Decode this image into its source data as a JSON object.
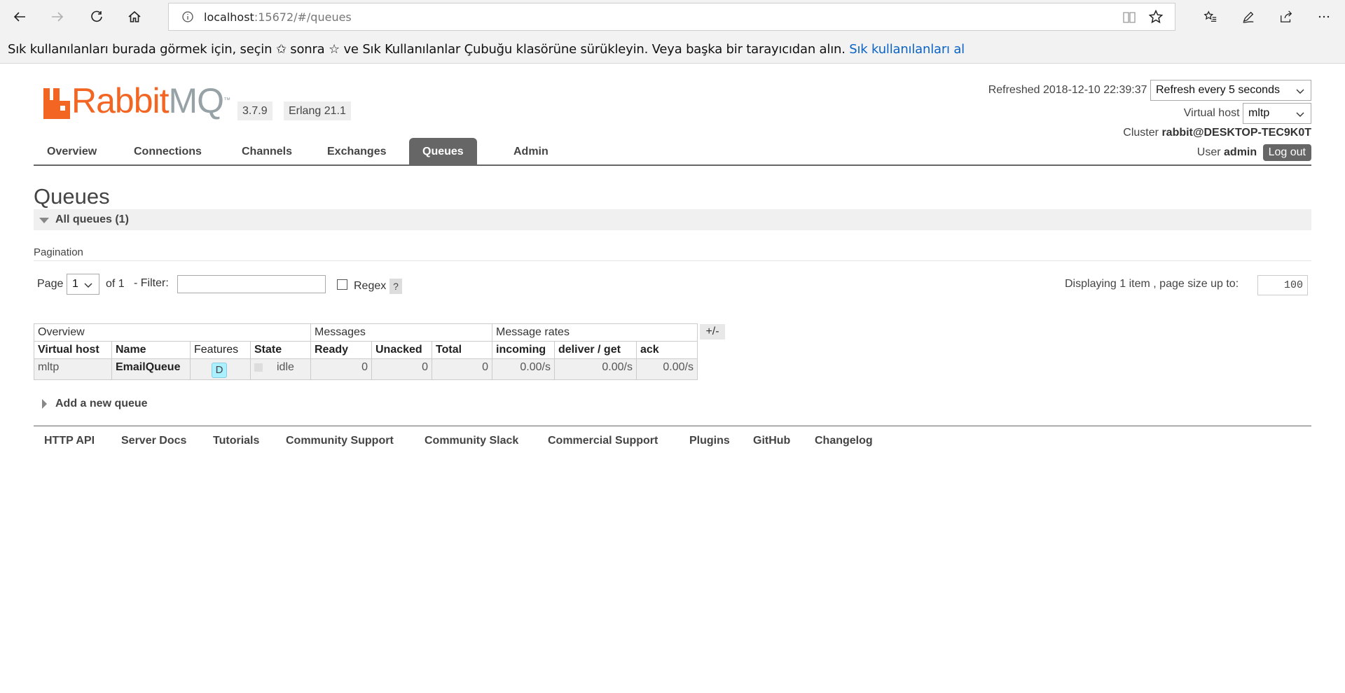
{
  "browser": {
    "url_host": "localhost",
    "url_path": ":15672/#/queues",
    "favorites_bar": {
      "text_before_icon": "Sık kullanılanları burada görmek için, seçin",
      "text_icon": "✩",
      "text_after_icon": "sonra ☆ ve Sık Kullanılanlar Çubuğu klasörüne sürükleyin. Veya başka bir tarayıcıdan alın.",
      "link": "Sık kullanılanları al"
    },
    "icons": [
      "back-icon",
      "forward-icon",
      "refresh-icon",
      "home-icon",
      "info-icon",
      "reading-view-icon",
      "favorite-star-icon",
      "favorites-list-icon",
      "pen-icon",
      "share-icon",
      "more-icon"
    ]
  },
  "header": {
    "logo_rabbit": "Rabbit",
    "logo_mq": "MQ",
    "logo_tm": "™",
    "version": "3.7.9",
    "erlang": "Erlang 21.1",
    "refreshed_label": "Refreshed",
    "refreshed_time": "2018-12-10 22:39:37",
    "refresh_select": "Refresh every 5 seconds",
    "vhost_label": "Virtual host",
    "vhost_select": "mltp",
    "cluster_label": "Cluster",
    "cluster_name": "rabbit@DESKTOP-TEC9K0T",
    "user_label": "User",
    "user_name": "admin",
    "logout": "Log out",
    "brand_color": "#f26522"
  },
  "tabs": [
    {
      "label": "Overview"
    },
    {
      "label": "Connections"
    },
    {
      "label": "Channels"
    },
    {
      "label": "Exchanges"
    },
    {
      "label": "Queues",
      "active": true
    },
    {
      "label": "Admin"
    }
  ],
  "main": {
    "title": "Queues",
    "section_label": "All queues (1)",
    "pagination": {
      "label": "Pagination",
      "page_label": "Page",
      "page_value": "1",
      "of_label": "of 1",
      "filter_label": "- Filter:",
      "filter_value": "",
      "regex_label": "Regex",
      "help": "?",
      "displaying": "Displaying 1 item , page size up to:",
      "page_size": "100"
    },
    "table": {
      "group_headers": [
        "Overview",
        "Messages",
        "Message rates"
      ],
      "column_toggle": "+/-",
      "columns": [
        "Virtual host",
        "Name",
        "Features",
        "State",
        "Ready",
        "Unacked",
        "Total",
        "incoming",
        "deliver / get",
        "ack"
      ],
      "rows": [
        {
          "virtual_host": "mltp",
          "name": "EmailQueue",
          "features": "D",
          "state": "idle",
          "ready": "0",
          "unacked": "0",
          "total": "0",
          "incoming": "0.00/s",
          "deliver_get": "0.00/s",
          "ack": "0.00/s"
        }
      ]
    },
    "add_queue": "Add a new queue"
  },
  "footer": {
    "links": [
      "HTTP API",
      "Server Docs",
      "Tutorials",
      "Community Support",
      "Community Slack",
      "Commercial Support",
      "Plugins",
      "GitHub",
      "Changelog"
    ]
  }
}
